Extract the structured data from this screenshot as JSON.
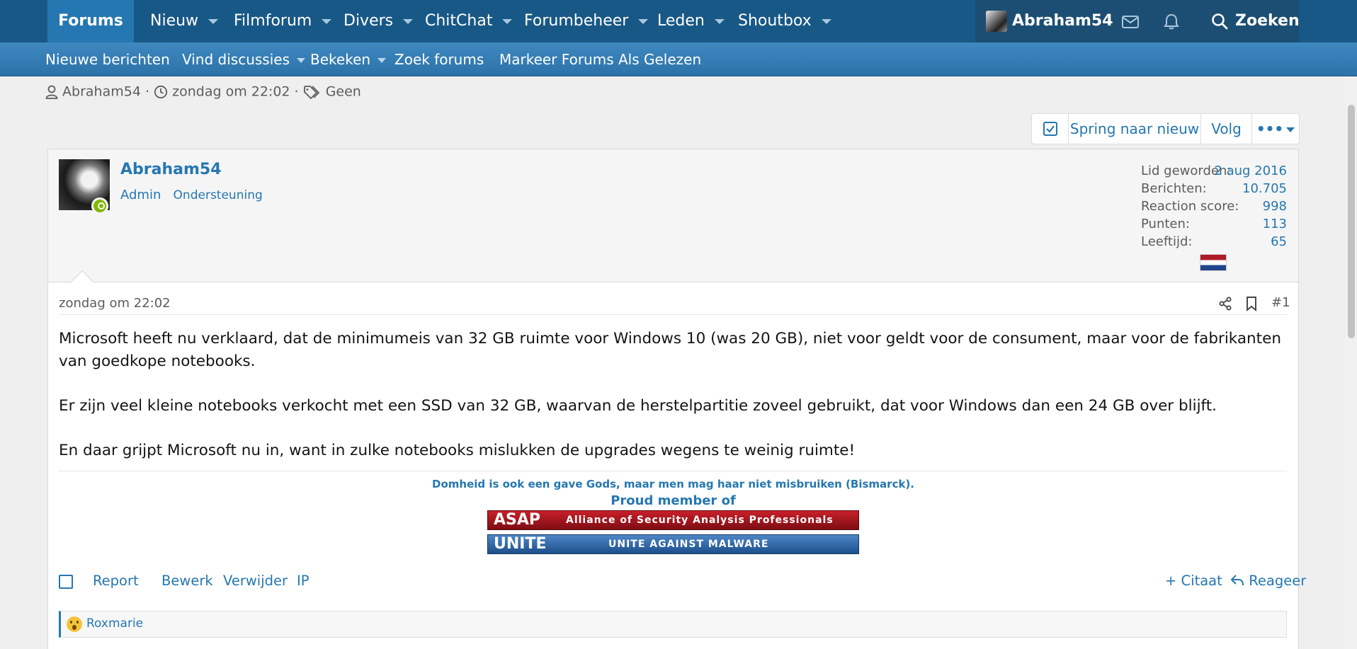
{
  "nav": {
    "tabs": [
      {
        "label": "Forums"
      },
      {
        "label": "Nieuw"
      },
      {
        "label": "Filmforum"
      },
      {
        "label": "Divers"
      },
      {
        "label": "ChitChat"
      },
      {
        "label": "Forumbeheer"
      },
      {
        "label": "Leden"
      },
      {
        "label": "Shoutbox"
      }
    ],
    "account_name": "Abraham54",
    "search_label": "Zoeken"
  },
  "subnav": {
    "items": [
      {
        "label": "Nieuwe berichten"
      },
      {
        "label": "Vind discussies"
      },
      {
        "label": "Bekeken"
      },
      {
        "label": "Zoek forums"
      },
      {
        "label": "Markeer Forums Als Gelezen"
      }
    ]
  },
  "thread_meta": {
    "author": "Abraham54",
    "date": "zondag om 22:02",
    "tags": "Geen",
    "sep": "·"
  },
  "thread_buttons": {
    "jump_new": "Spring naar nieuw",
    "follow": "Volg",
    "more": "•••"
  },
  "post": {
    "username": "Abraham54",
    "title_admin": "Admin",
    "title_support": "Ondersteuning",
    "stats": [
      {
        "label": "Lid geworden:",
        "value": "2 aug 2016"
      },
      {
        "label": "Berichten:",
        "value": "10.705"
      },
      {
        "label": "Reaction score:",
        "value": "998"
      },
      {
        "label": "Punten:",
        "value": "113"
      },
      {
        "label": "Leeftijd:",
        "value": "65"
      }
    ],
    "date": "zondag om 22:02",
    "number": "#1",
    "paragraphs": [
      "Microsoft heeft nu verklaard, dat de minimumeis van 32 GB ruimte voor Windows 10 (was 20 GB), niet voor geldt voor de consument, maar voor de fabrikanten van goedkope notebooks.",
      "Er zijn veel kleine notebooks verkocht met een SSD van 32 GB, waarvan de herstelpartitie zoveel gebruikt, dat voor Windows dan een 24 GB over blijft.",
      "En daar grijpt Microsoft nu in, want in zulke notebooks mislukken de upgrades wegens te weinig ruimte!"
    ],
    "signature_quote": "Domheid is ook een gave Gods, maar men mag haar niet misbruiken (Bismarck).",
    "signature_member": "Proud member of",
    "banner_asap_big": "ASAP",
    "banner_asap_small": "Alliance of Security Analysis Professionals",
    "banner_unite_big": "UNITE",
    "banner_unite_small": "UNITE AGAINST MALWARE",
    "actions": {
      "report": "Report",
      "edit": "Bewerk",
      "delete": "Verwijder",
      "ip": "IP",
      "quote": "+ Citaat",
      "reply": "Reageer"
    },
    "reaction_user": "Roxmarie"
  },
  "colors": {
    "nav_bg": "#185886",
    "nav_active": "#2577b1",
    "link": "#2577b1"
  }
}
